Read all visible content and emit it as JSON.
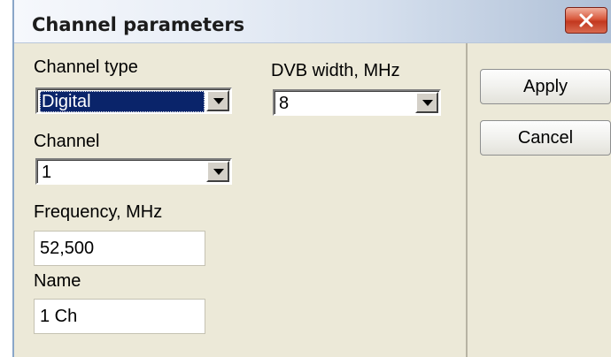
{
  "window": {
    "title": "Channel parameters"
  },
  "form": {
    "channel_type": {
      "label": "Channel type",
      "value": "Digital"
    },
    "dvb_width": {
      "label": "DVB width, MHz",
      "value": "8"
    },
    "channel": {
      "label": "Channel",
      "value": "1"
    },
    "frequency": {
      "label": "Frequency, MHz",
      "value": "52,500"
    },
    "name": {
      "label": "Name",
      "value": "1 Ch"
    }
  },
  "buttons": {
    "apply": "Apply",
    "cancel": "Cancel"
  },
  "colors": {
    "selection": "#0a246a",
    "dialog_bg": "#ece9d8",
    "close_button": "#d9583c"
  },
  "icons": {
    "close": "close-icon",
    "dropdown": "chevron-down-icon"
  }
}
